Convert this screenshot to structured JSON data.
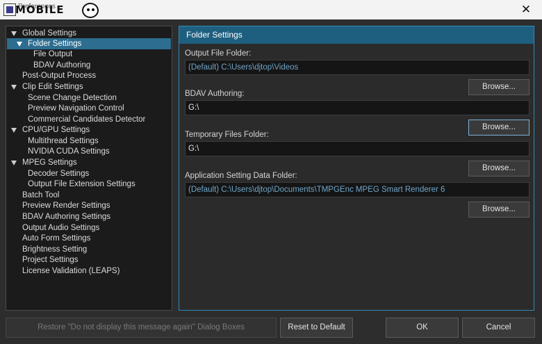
{
  "window": {
    "title": "Preferences",
    "logo_text": "MOBILE",
    "close_glyph": "✕"
  },
  "tree": {
    "items": [
      {
        "label": "Global Settings",
        "expanded": true
      },
      {
        "label": "Folder Settings",
        "expanded": true,
        "selected": true
      },
      {
        "label": "File Output"
      },
      {
        "label": "BDAV Authoring"
      },
      {
        "label": "Post-Output Process"
      },
      {
        "label": "Clip Edit Settings",
        "expanded": true
      },
      {
        "label": "Scene Change Detection"
      },
      {
        "label": "Preview Navigation Control"
      },
      {
        "label": "Commercial Candidates Detector"
      },
      {
        "label": "CPU/GPU Settings",
        "expanded": true
      },
      {
        "label": "Multithread Settings"
      },
      {
        "label": "NVIDIA CUDA Settings"
      },
      {
        "label": "MPEG Settings",
        "expanded": true
      },
      {
        "label": "Decoder Settings"
      },
      {
        "label": "Output File Extension Settings"
      },
      {
        "label": "Batch Tool"
      },
      {
        "label": "Preview Render Settings"
      },
      {
        "label": "BDAV Authoring Settings"
      },
      {
        "label": "Output Audio Settings"
      },
      {
        "label": "Auto Form Settings"
      },
      {
        "label": "Brightness Setting"
      },
      {
        "label": "Project Settings"
      },
      {
        "label": "License Validation (LEAPS)"
      }
    ]
  },
  "panel": {
    "title": "Folder Settings",
    "fields": [
      {
        "label": "Output File Folder:",
        "value": "(Default) C:\\Users\\djtop\\Videos",
        "browse": "Browse..."
      },
      {
        "label": "BDAV Authoring:",
        "value": "G:\\",
        "browse": "Browse..."
      },
      {
        "label": "Temporary Files Folder:",
        "value": "G:\\",
        "browse": "Browse..."
      },
      {
        "label": "Application Setting Data Folder:",
        "value": "(Default) C:\\Users\\djtop\\Documents\\TMPGEnc MPEG Smart Renderer 6",
        "browse": "Browse..."
      }
    ]
  },
  "buttons": {
    "restore": "Restore \"Do not display this message again\" Dialog Boxes",
    "reset": "Reset to Default",
    "ok": "OK",
    "cancel": "Cancel"
  },
  "colors": {
    "selection": "#2c6d90",
    "header": "#1e5f80",
    "default_path": "#6fa6c8"
  }
}
